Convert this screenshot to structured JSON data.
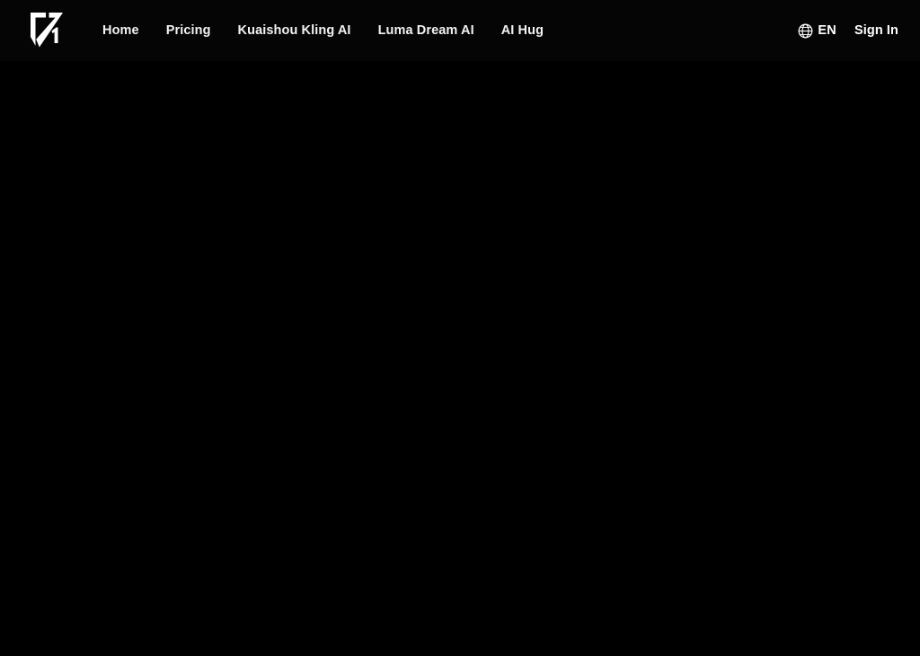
{
  "site": {
    "background_color": "#000000",
    "header_background_color": "#050505",
    "text_color": "#f2f2f2",
    "accent_color": "#ffffff"
  },
  "header": {
    "logo": {
      "icon": "v1-logo-icon",
      "alt_text": "V1"
    },
    "nav": [
      {
        "label": "Home"
      },
      {
        "label": "Pricing"
      },
      {
        "label": "Kuaishou Kling AI"
      },
      {
        "label": "Luma Dream AI"
      },
      {
        "label": "AI Hug"
      }
    ],
    "language": {
      "icon": "globe-icon",
      "label": "EN"
    },
    "sign_in": {
      "label": "Sign In"
    }
  },
  "main": {
    "content": ""
  }
}
